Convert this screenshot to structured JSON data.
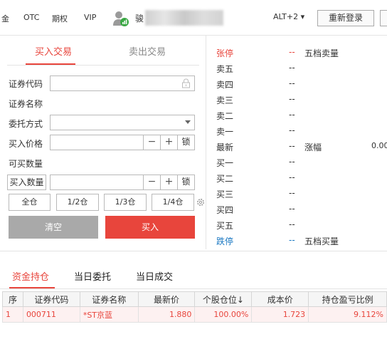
{
  "topbar": {
    "nav_items": [
      "金",
      "OTC",
      "期权",
      "VIP"
    ],
    "user_prefix": "骏",
    "alt_select": "ALT+2 ▾",
    "relogin_label": "重新登录"
  },
  "trade_tabs": {
    "buy": "买入交易",
    "sell": "卖出交易"
  },
  "form": {
    "code_label": "证券代码",
    "code_value": "",
    "name_label": "证券名称",
    "name_value": "",
    "order_type_label": "委托方式",
    "order_type_value": "",
    "price_label": "买入价格",
    "price_value": "",
    "minus": "−",
    "plus": "+",
    "lock": "锁",
    "available_label": "可买数量",
    "qty_label": "买入数量",
    "qty_value": "",
    "position_buttons": [
      "全仓",
      "1/2仓",
      "1/3仓",
      "1/4仓"
    ],
    "clear_label": "清空",
    "buy_label": "买入"
  },
  "orderbook": {
    "limit_up": {
      "label": "张停",
      "value": "--",
      "extra": "五档卖量"
    },
    "asks": [
      {
        "label": "卖五",
        "value": "--"
      },
      {
        "label": "卖四",
        "value": "--"
      },
      {
        "label": "卖三",
        "value": "--"
      },
      {
        "label": "卖二",
        "value": "--"
      },
      {
        "label": "卖一",
        "value": "--"
      }
    ],
    "latest": {
      "label": "最新",
      "value": "--",
      "extra": "涨幅",
      "extra_value": "0.00"
    },
    "bids": [
      {
        "label": "买一",
        "value": "--"
      },
      {
        "label": "买二",
        "value": "--"
      },
      {
        "label": "买三",
        "value": "--"
      },
      {
        "label": "买四",
        "value": "--"
      },
      {
        "label": "买五",
        "value": "--"
      }
    ],
    "limit_down": {
      "label": "跌停",
      "value": "--",
      "extra": "五档买量"
    }
  },
  "bottom_tabs": [
    "资金持仓",
    "当日委托",
    "当日成交"
  ],
  "holdings": {
    "columns": [
      "序",
      "证券代码",
      "证券名称",
      "最新价",
      "个股仓位↓",
      "成本价",
      "持仓盈亏比例"
    ],
    "rows": [
      [
        "1",
        "000711",
        "*ST京蓝",
        "1.880",
        "100.00%",
        "1.723",
        "9.112%"
      ]
    ]
  },
  "colors": {
    "accent": "#e8453c",
    "limit_down": "#1a78c2"
  }
}
